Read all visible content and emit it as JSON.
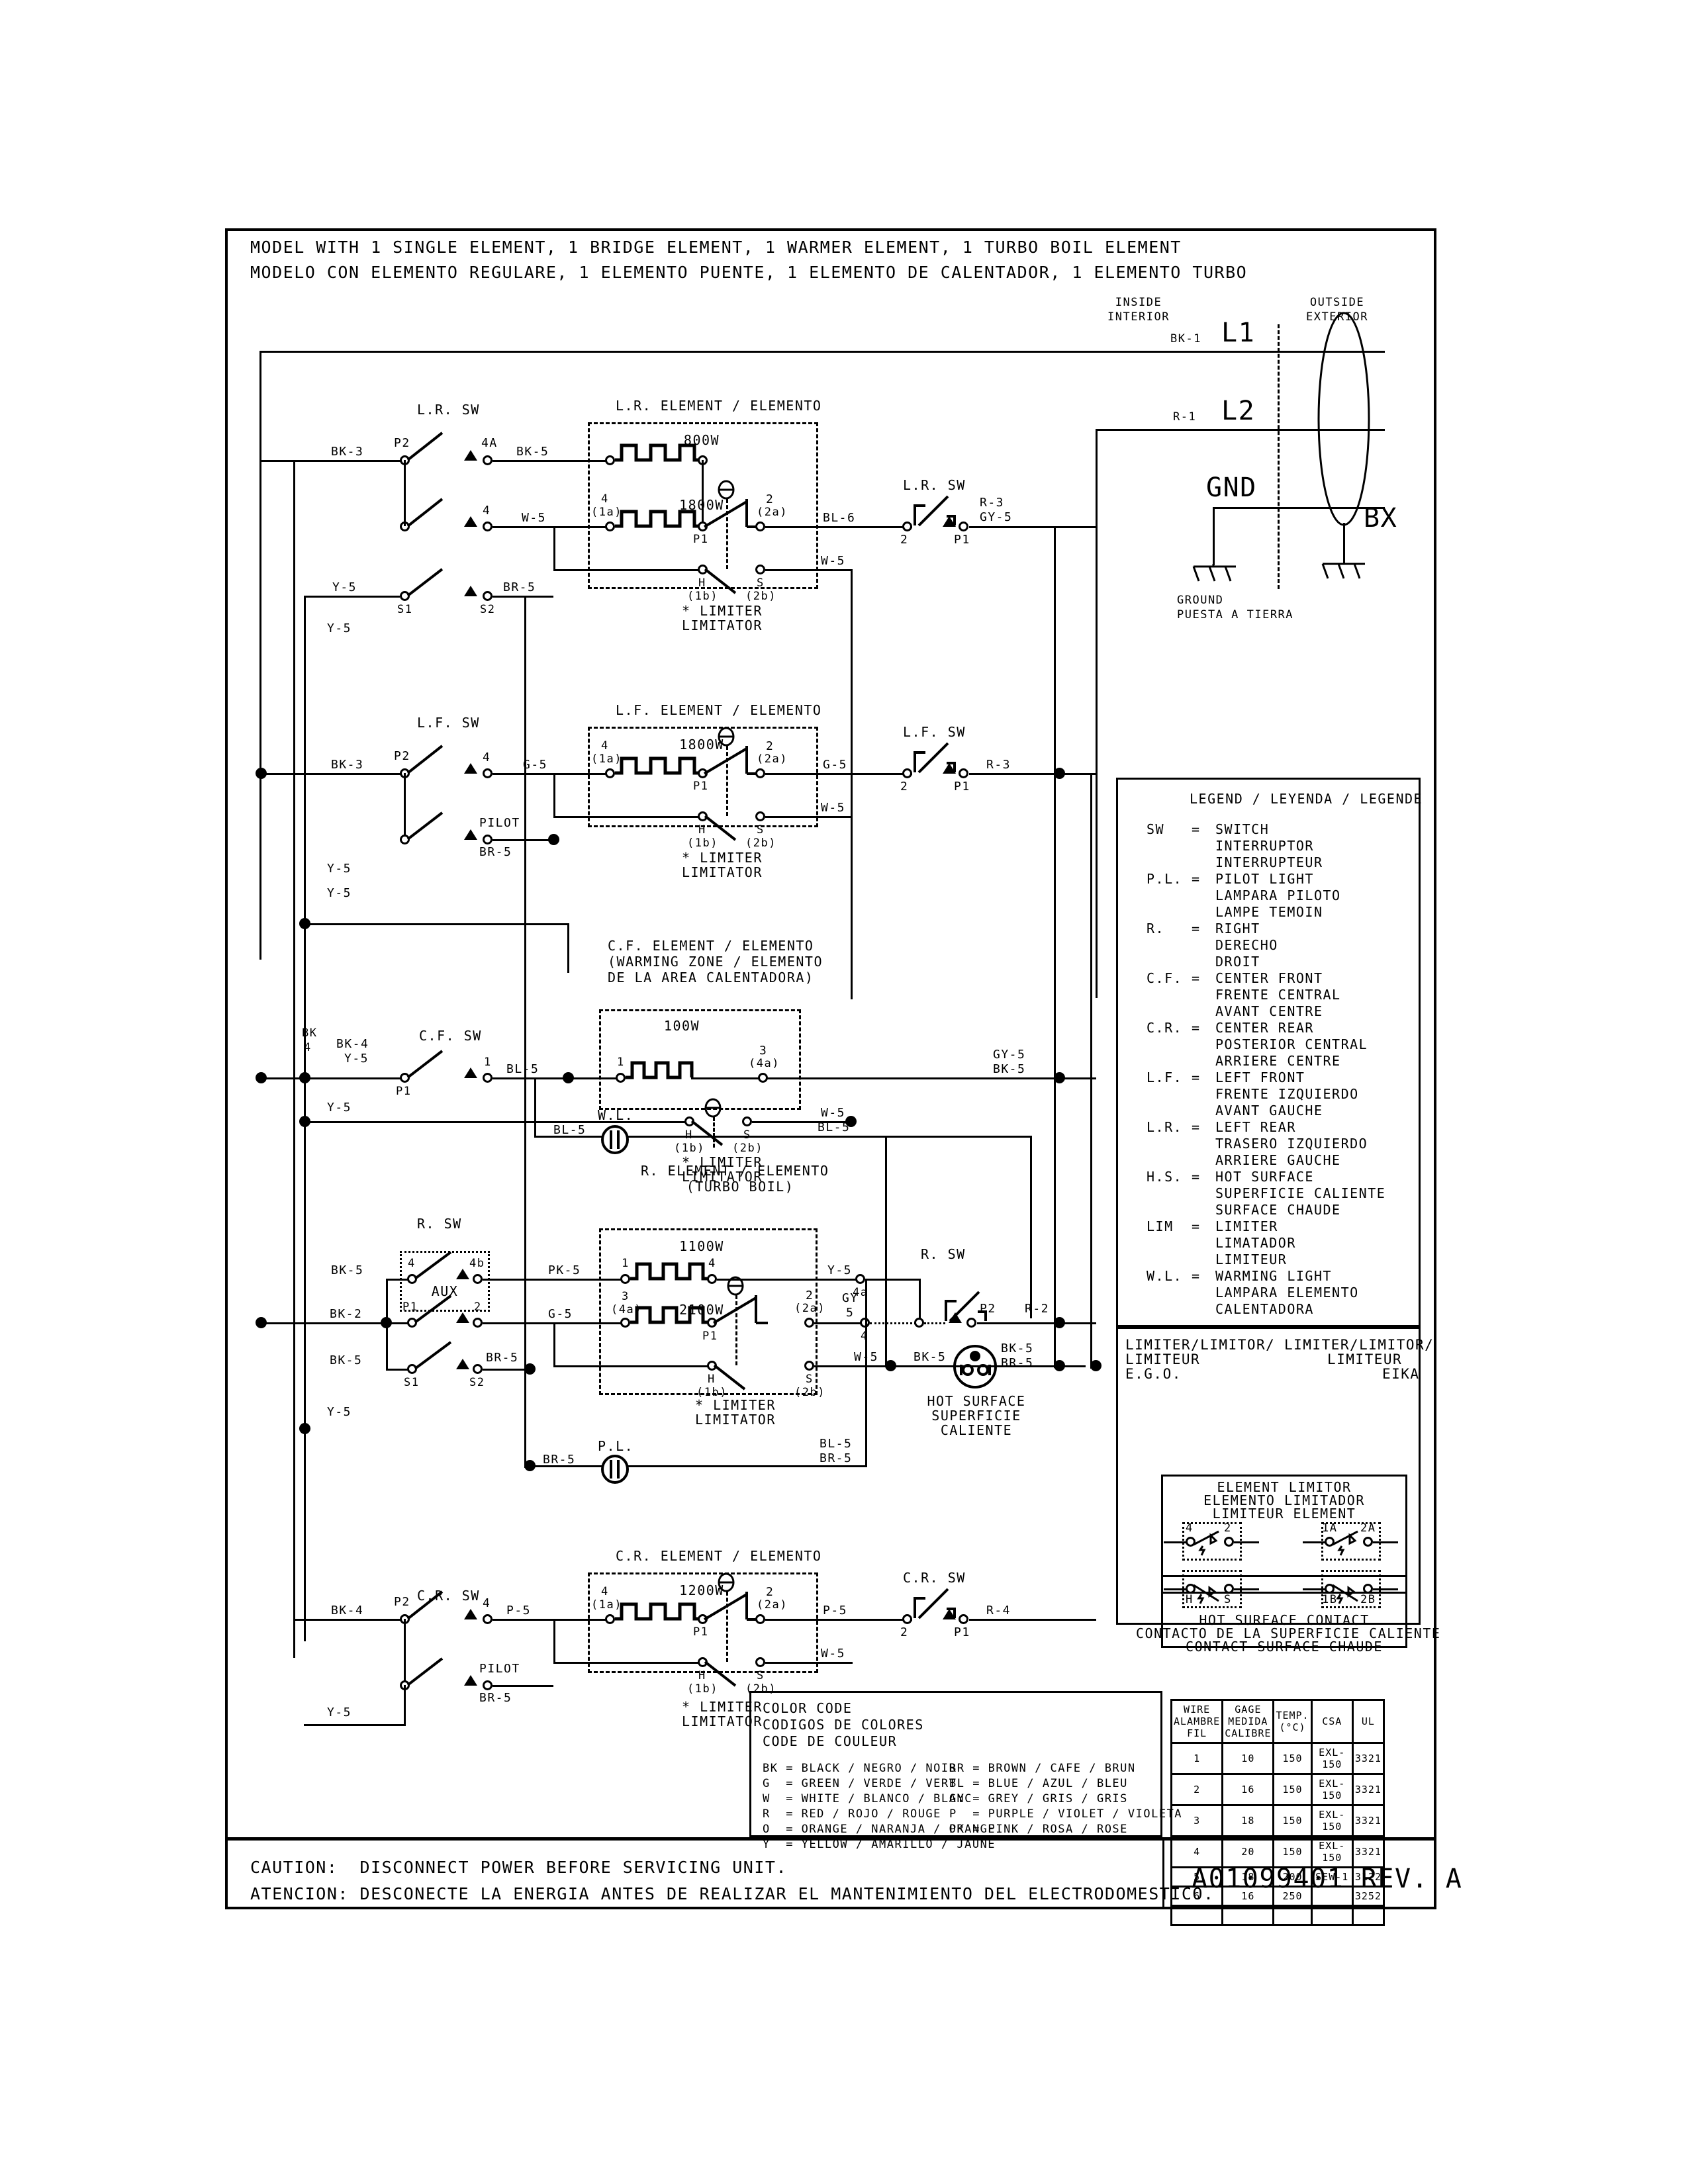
{
  "title": {
    "line1": "MODEL WITH 1 SINGLE ELEMENT, 1 BRIDGE ELEMENT, 1 WARMER ELEMENT, 1 TURBO BOIL ELEMENT",
    "line2": "MODELO CON ELEMENTO REGULARE, 1 ELEMENTO PUENTE, 1 ELEMENTO DE CALENTADOR, 1 ELEMENTO TURBO"
  },
  "supply": {
    "inside_1": "INSIDE",
    "inside_2": "INTERIOR",
    "outside_1": "OUTSIDE",
    "outside_2": "EXTERIOR",
    "l1": "L1",
    "l2": "L2",
    "gnd": "GND",
    "bx": "BX",
    "l1_wire": "BK-1",
    "l2_wire": "R-1",
    "ground_1": "GROUND",
    "ground_2": "PUESTA A TIERRA"
  },
  "limiter_note": {
    "line1": "* LIMITER",
    "line2": "LIMITATOR"
  },
  "elements": {
    "lr": {
      "heading": "L.R. ELEMENT / ELEMENTO",
      "sw_label": "L.R. SW",
      "sw2_label": "L.R. SW",
      "watt_top": "800W",
      "watt_bot": "1800W",
      "in_wire_top": "BK-3",
      "in_wire_mid": "BK-5",
      "in_wire_bot": "W-5",
      "p2": "P2",
      "term_4A": "4A",
      "term_4": "4",
      "term_4_1a": "4",
      "term_1a": "(1a)",
      "p1": "P1",
      "term_2": "2",
      "term_2a": "(2a)",
      "term_H": "H",
      "term_1b": "(1b)",
      "term_S": "S",
      "term_2b": "(2b)",
      "out_wire": "BL-6",
      "out_term2": "2",
      "out_p1": "P1",
      "out_wire2_a": "R-3",
      "out_wire2_b": "GY-5",
      "w5": "W-5",
      "s1_wire": "Y-5",
      "s1": "S1",
      "s2": "S2",
      "s2_wire": "BR-5",
      "y5_low": "Y-5"
    },
    "lf": {
      "heading": "L.F. ELEMENT / ELEMENTO",
      "sw_label": "L.F. SW",
      "sw2_label": "L.F. SW",
      "watt": "1800W",
      "in_wire": "BK-3",
      "p2": "P2",
      "term_4": "4",
      "wire_g5": "G-5",
      "term_4_1a": "4",
      "term_1a": "(1a)",
      "p1": "P1",
      "term_2": "2",
      "term_2a": "(2a)",
      "term_H": "H",
      "term_1b": "(1b)",
      "term_S": "S",
      "term_2b": "(2b)",
      "out_wire": "G-5",
      "out_term2": "2",
      "out_p1": "P1",
      "out_wire2": "R-3",
      "w5": "W-5",
      "pilot": "PILOT",
      "pilot_wire": "BR-5",
      "y5_low": "Y-5"
    },
    "cf": {
      "heading": "C.F. ELEMENT / ELEMENTO",
      "heading2": "(WARMING ZONE / ELEMENTO",
      "heading3": "DE LA AREA CALENTADORA)",
      "sw_label": "C.F. SW",
      "watt": "100W",
      "bk_label1": "BK",
      "bk_label2": "4",
      "in_wire1": "BK-4",
      "in_wire2": "Y-5",
      "p1": "P1",
      "term_1": "1",
      "wire_bl5": "BL-5",
      "term_1b_in": "1",
      "term_3": "3",
      "term_4a": "(4a)",
      "term_H": "H",
      "term_1b": "(1b)",
      "term_S": "S",
      "term_2b": "(2b)",
      "w5": "W-5",
      "out_wire1": "GY-5",
      "out_wire2": "BK-5",
      "y5_top": "Y-5",
      "y5_bot": "Y-5"
    },
    "r": {
      "heading": "R. ELEMENT / ELEMENTO",
      "heading2": "(TURBO BOIL)",
      "sw_label": "R. SW",
      "sw2_label": "R. SW",
      "aux": "AUX",
      "watt_top": "1100W",
      "watt_bot": "2100W",
      "in_wire_top": "BK-5",
      "in_wire_bot": "BK-2",
      "term_4": "4",
      "term_4b": "4b",
      "wire_pk5": "PK-5",
      "term_1": "1",
      "term_4r": "4",
      "p1_sw": "P1",
      "term_2": "2",
      "wire_g5": "G-5",
      "term_3": "3",
      "term_4a": "(4a)",
      "p1": "P1",
      "term_2e": "2",
      "term_2a": "(2a)",
      "term_H": "H",
      "term_1b": "(1b)",
      "term_S": "S",
      "term_2b": "(2b)",
      "y5_out": "Y-5",
      "term_4a_out": "4a",
      "gy": "GY",
      "five": "5",
      "term_4_gy": "4",
      "w5": "W-5",
      "bk5_hs": "BK-5",
      "p2": "P2",
      "r2": "R-2",
      "hs_wire1": "BK-5",
      "hs_wire2": "BR-5",
      "hot_surface_1": "HOT SURFACE",
      "hot_surface_2": "SUPERFICIE",
      "hot_surface_3": "CALIENTE",
      "s1_wire": "BK-5",
      "s1": "S1",
      "s2": "S2",
      "s2_wire": "BR-5",
      "y5_low": "Y-5"
    },
    "cr": {
      "heading": "C.R. ELEMENT / ELEMENTO",
      "sw_label": "C.R. SW",
      "sw2_label": "C.R. SW",
      "watt": "1200W",
      "in_wire": "BK-4",
      "p2": "P2",
      "term_4": "4",
      "wire_p5": "P-5",
      "term_4_1a": "4",
      "term_1a": "(1a)",
      "p1": "P1",
      "term_2": "2",
      "term_2a": "(2a)",
      "term_H": "H",
      "term_1b": "(1b)",
      "term_S": "S",
      "term_2b": "(2b)",
      "out_wire": "P-5",
      "out_term2": "2",
      "out_p1": "P1",
      "out_wire2": "R-4",
      "w5": "W-5",
      "pilot": "PILOT",
      "pilot_wire": "BR-5",
      "y5_low": "Y-5"
    },
    "wl": {
      "label": "W.L.",
      "wire_left": "BL-5",
      "wire_right": "BL-5"
    },
    "pl": {
      "label": "P.L.",
      "wire_left": "BR-5",
      "wire_right1": "BL-5",
      "wire_right2": "BR-5"
    }
  },
  "legend": {
    "title": "LEGEND / LEYENDA / LEGENDE",
    "entries": [
      {
        "abbr": "SW",
        "eq": "=",
        "lines": [
          "SWITCH",
          "INTERRUPTOR",
          "INTERRUPTEUR"
        ]
      },
      {
        "abbr": "P.L.",
        "eq": "=",
        "lines": [
          "PILOT LIGHT",
          "LAMPARA PILOTO",
          "LAMPE TEMOIN"
        ]
      },
      {
        "abbr": "R.",
        "eq": "=",
        "lines": [
          "RIGHT",
          "DERECHO",
          "DROIT"
        ]
      },
      {
        "abbr": "C.F.",
        "eq": "=",
        "lines": [
          "CENTER FRONT",
          "FRENTE CENTRAL",
          "AVANT CENTRE"
        ]
      },
      {
        "abbr": "C.R.",
        "eq": "=",
        "lines": [
          "CENTER REAR",
          "POSTERIOR CENTRAL",
          "ARRIERE CENTRE"
        ]
      },
      {
        "abbr": "L.F.",
        "eq": "=",
        "lines": [
          "LEFT FRONT",
          "FRENTE IZQUIERDO",
          "AVANT GAUCHE"
        ]
      },
      {
        "abbr": "L.R.",
        "eq": "=",
        "lines": [
          "LEFT REAR",
          "TRASERO IZQUIERDO",
          "ARRIERE GAUCHE"
        ]
      },
      {
        "abbr": "H.S.",
        "eq": "=",
        "lines": [
          "HOT SURFACE",
          "SUPERFICIE CALIENTE",
          "SURFACE CHAUDE"
        ]
      },
      {
        "abbr": "LIM",
        "eq": "=",
        "lines": [
          "LIMITER",
          "LIMATADOR",
          "LIMITEUR"
        ]
      },
      {
        "abbr": "W.L.",
        "eq": "=",
        "lines": [
          "WARMING LIGHT",
          "LAMPARA ELEMENTO",
          "CALENTADORA"
        ]
      }
    ]
  },
  "limiter_panel": {
    "left_label_1": "LIMITER/LIMITOR/",
    "left_label_2": "LIMITEUR",
    "left_label_3": "E.G.O.",
    "right_label_1": "LIMITER/LIMITOR/",
    "right_label_2": "LIMITEUR",
    "right_label_3": "EIKA",
    "box_title_1": "ELEMENT LIMITOR",
    "box_title_2": "ELEMENTO LIMITADOR",
    "box_title_3": "LIMITEUR ELEMENT",
    "ego_top_left": "4",
    "ego_top_right": "2",
    "eika_top_left": "1A",
    "eika_top_right": "2A",
    "ego_bot_left": "H",
    "ego_bot_right": "S",
    "eika_bot_left": "1B",
    "eika_bot_right": "2B",
    "box_footer_1": "HOT SURFACE CONTACT",
    "box_footer_2": "CONTACTO DE LA SUPERFICIE CALIENTE",
    "box_footer_3": "CONTACT SURFACE CHAUDE"
  },
  "color_code": {
    "title_1": "COLOR CODE",
    "title_2": "CODIGOS DE COLORES",
    "title_3": "CODE DE COULEUR",
    "left_col": [
      "BK = BLACK / NEGRO / NOIR",
      "G  = GREEN / VERDE / VERT",
      "W  = WHITE / BLANCO / BLANC",
      "R  = RED / ROJO / ROUGE",
      "O  = ORANGE / NARANJA / ORANGE",
      "Y  = YELLOW / AMARILLO / JAUNE"
    ],
    "right_col": [
      "BR = BROWN / CAFE / BRUN",
      "BL = BLUE / AZUL / BLEU",
      "GY = GREY / GRIS / GRIS",
      "P  = PURPLE / VIOLET / VIOLETA",
      "PK = PINK / ROSA / ROSE"
    ]
  },
  "wire_table": {
    "headers": [
      [
        "WIRE",
        "ALAMBRE",
        "FIL"
      ],
      [
        "GAGE",
        "MEDIDA",
        "CALIBRE"
      ],
      [
        "TEMP.",
        "(°C)",
        ""
      ],
      [
        "CSA",
        "",
        ""
      ],
      [
        "UL",
        "",
        ""
      ]
    ],
    "rows": [
      [
        "1",
        "10",
        "150",
        "EXL-150",
        "3321"
      ],
      [
        "2",
        "16",
        "150",
        "EXL-150",
        "3321"
      ],
      [
        "3",
        "18",
        "150",
        "EXL-150",
        "3321"
      ],
      [
        "4",
        "20",
        "150",
        "EXL-150",
        "3321"
      ],
      [
        "5",
        "18",
        "200",
        "SEW-1",
        "3122"
      ],
      [
        "6",
        "16",
        "250",
        "",
        "3252"
      ],
      [
        "",
        "",
        "",
        "",
        ""
      ]
    ]
  },
  "footer": {
    "caution_en": "CAUTION:  DISCONNECT POWER BEFORE SERVICING UNIT.",
    "caution_es": "ATENCION: DESCONECTE LA ENERGIA ANTES DE REALIZAR EL MANTENIMIENTO DEL ELECTRODOMESTICO.",
    "part_number": "A01099401 REV. A"
  }
}
